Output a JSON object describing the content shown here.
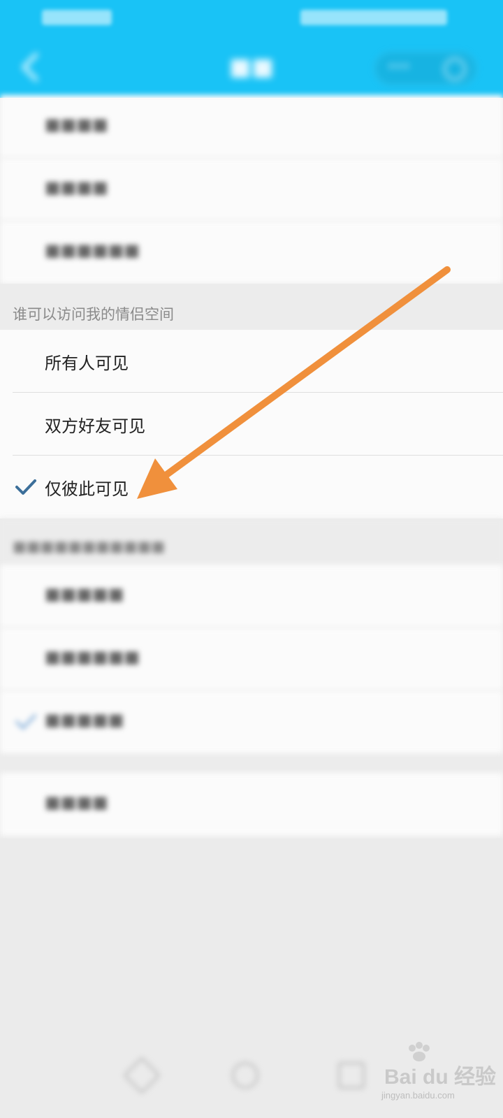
{
  "section_visibility": {
    "header": "谁可以访问我的情侣空间",
    "options": [
      {
        "label": "所有人可见",
        "checked": false
      },
      {
        "label": "双方好友可见",
        "checked": false
      },
      {
        "label": "仅彼此可见",
        "checked": true
      }
    ]
  },
  "colors": {
    "header_bg": "#19c3f6",
    "check": "#3c6f9a",
    "annotation_arrow": "#f0903c"
  },
  "icons": {
    "check": "check-icon",
    "back": "back-arrow-icon",
    "annotation": "annotation-arrow-icon",
    "watermark": "baidu-paw-logo"
  },
  "watermark": {
    "brand": "Bai du 经验",
    "domain": "jingyan.baidu.com"
  }
}
